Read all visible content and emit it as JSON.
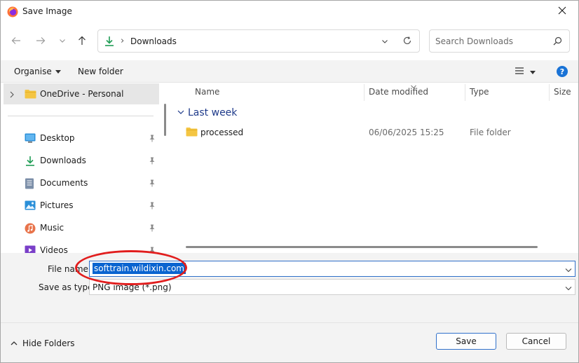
{
  "window": {
    "title": "Save Image"
  },
  "address": {
    "path": "Downloads",
    "separator": "›"
  },
  "search": {
    "placeholder": "Search Downloads"
  },
  "toolbar": {
    "organise_label": "Organise",
    "new_folder_label": "New folder",
    "help_label": "?"
  },
  "sidebar": {
    "onedrive_label": "OneDrive - Personal",
    "items": [
      {
        "label": "Desktop",
        "icon": "desktop-icon"
      },
      {
        "label": "Downloads",
        "icon": "download-icon"
      },
      {
        "label": "Documents",
        "icon": "document-icon"
      },
      {
        "label": "Pictures",
        "icon": "picture-icon"
      },
      {
        "label": "Music",
        "icon": "music-icon"
      },
      {
        "label": "Videos",
        "icon": "video-icon"
      }
    ]
  },
  "columns": {
    "name": "Name",
    "date_modified": "Date modified",
    "type": "Type",
    "size": "Size"
  },
  "groups": [
    {
      "label": "Last week",
      "files": [
        {
          "name": "processed",
          "date": "06/06/2025 15:25",
          "type": "File folder"
        }
      ]
    }
  ],
  "form": {
    "file_name_label": "File name:",
    "file_name_value": "softtrain.wildixin.com",
    "save_as_type_label": "Save as type:",
    "save_as_type_value": "PNG image (*.png)"
  },
  "footer": {
    "hide_folders_label": "Hide Folders",
    "save_label": "Save",
    "cancel_label": "Cancel"
  },
  "colors": {
    "accent": "#0a64d0",
    "annotation": "#e11d1d"
  }
}
